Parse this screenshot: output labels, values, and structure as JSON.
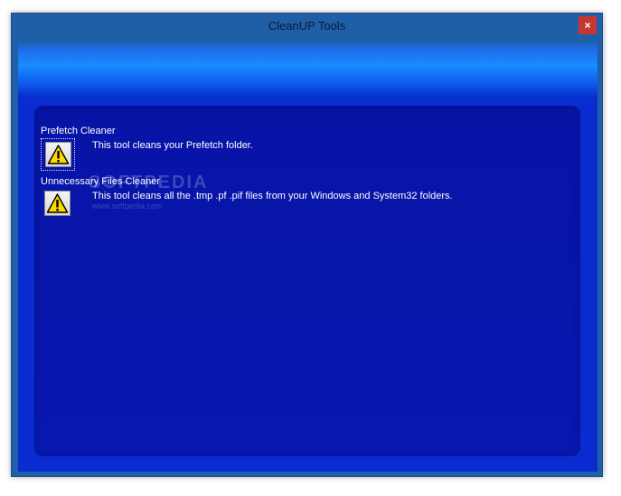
{
  "window": {
    "title": "CleanUP Tools",
    "close_glyph": "×"
  },
  "tools": [
    {
      "name": "Prefetch Cleaner",
      "description": "This tool cleans your Prefetch folder.",
      "icon": "warning-icon"
    },
    {
      "name": "Unnecessary Files Cleaner",
      "description": "This tool cleans all the .tmp .pf .pif files from your Windows and System32 folders.",
      "icon": "warning-icon"
    }
  ],
  "watermark": {
    "brand": "SOFTPEDIA",
    "url": "www.softpedia.com"
  },
  "colors": {
    "titlebar": "#1f5fa8",
    "close_button": "#c7372f",
    "panel": "#0714a6",
    "text": "#ffffff"
  }
}
